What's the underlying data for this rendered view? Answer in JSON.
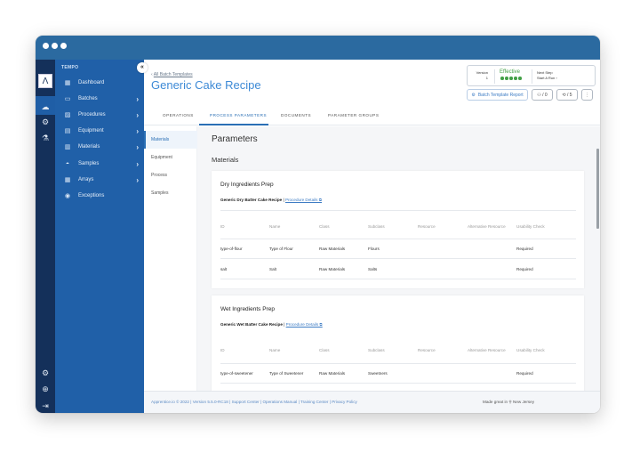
{
  "window": {
    "controls": [
      "close",
      "minimize",
      "maximize"
    ]
  },
  "rail": {
    "logo": "Λ",
    "icons": [
      {
        "name": "cloud-icon",
        "glyph": "☁",
        "active": true
      },
      {
        "name": "settings-circle-icon",
        "glyph": "⚙",
        "active": false
      },
      {
        "name": "analytics-icon",
        "glyph": "⚗",
        "active": false
      }
    ],
    "bottom_icons": [
      {
        "name": "gear-icon",
        "glyph": "⚙"
      },
      {
        "name": "help-icon",
        "glyph": "⊕"
      },
      {
        "name": "logout-icon",
        "glyph": "⇥"
      }
    ]
  },
  "sidebar": {
    "brand": "TEMPO",
    "collapse_glyph": "«",
    "items": [
      {
        "label": "Dashboard",
        "icon": "▦",
        "chevron": false
      },
      {
        "label": "Batches",
        "icon": "▭",
        "chevron": true
      },
      {
        "label": "Procedures",
        "icon": "▨",
        "chevron": true
      },
      {
        "label": "Equipment",
        "icon": "▤",
        "chevron": true
      },
      {
        "label": "Materials",
        "icon": "▥",
        "chevron": true
      },
      {
        "label": "Samples",
        "icon": "◓",
        "chevron": true
      },
      {
        "label": "Arrays",
        "icon": "▦",
        "chevron": true
      },
      {
        "label": "Exceptions",
        "icon": "◉",
        "chevron": false
      }
    ]
  },
  "header": {
    "breadcrumb_back": "‹",
    "breadcrumb": "All Batch Templates",
    "title": "Generic Cake Recipe",
    "version_label": "Version",
    "version_value": "1",
    "status": "Effective",
    "status_color": "#43a047",
    "status_steps": 5,
    "next_step_label": "Next Step",
    "next_step_value": "Start A Run",
    "next_step_chevron": "›",
    "report_button": "Batch Template Report",
    "report_icon": "⚙",
    "users_count": "/ 0",
    "users_icon": "👥",
    "tags_count": "/ 5",
    "tags_icon": "⟲",
    "more_icon": "⋮"
  },
  "tabs": [
    {
      "label": "OPERATIONS",
      "active": false
    },
    {
      "label": "PROCESS PARAMETERS",
      "active": true
    },
    {
      "label": "DOCUMENTS",
      "active": false
    },
    {
      "label": "PARAMETER GROUPS",
      "active": false
    }
  ],
  "subnav": [
    {
      "label": "Materials",
      "active": true
    },
    {
      "label": "Equipment",
      "active": false
    },
    {
      "label": "Process",
      "active": false
    },
    {
      "label": "Samples",
      "active": false
    }
  ],
  "content": {
    "heading": "Parameters",
    "section": "Materials",
    "columns": [
      "ID",
      "Name",
      "Class",
      "Subclass",
      "Resource",
      "Alternative Resource",
      "Usability Check"
    ],
    "cards": [
      {
        "title": "Dry Ingredients Prep",
        "procedure": "Generic Dry Batter Cake Recipe",
        "separator": " | ",
        "link": "Procedure Details ⧉",
        "rows": [
          [
            "type-of-flour",
            "Type of Flour",
            "Raw Materials",
            "Flours",
            "",
            "",
            "Required"
          ],
          [
            "salt",
            "Salt",
            "Raw Materials",
            "Salts",
            "",
            "",
            "Required"
          ]
        ]
      },
      {
        "title": "Wet Ingredients Prep",
        "procedure": "Generic Wet Batter Cake Recipe",
        "separator": " | ",
        "link": "Procedure Details ⧉",
        "rows": [
          [
            "type-of-sweetener",
            "Type of Sweetener",
            "Raw Materials",
            "Sweetners",
            "",
            "",
            "Required"
          ]
        ]
      }
    ]
  },
  "footer": {
    "copyright": "Apprentice.io © 2022 | Version 5.5.0-RC18 |",
    "links": [
      "Support Center",
      "Operations Manual",
      "Training Center",
      "Privacy Policy"
    ],
    "made_in": "Made great in",
    "made_in_icon": "⚲",
    "location": "New Jersey"
  }
}
